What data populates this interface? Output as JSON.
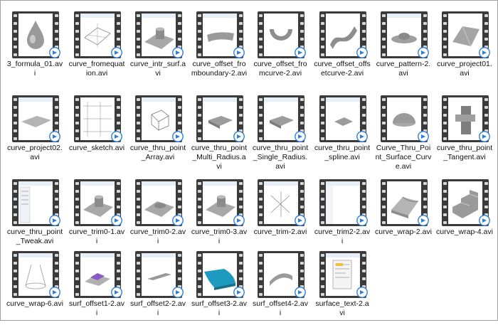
{
  "window": {
    "title": ""
  },
  "files": [
    {
      "name": "3_formula_01.avi",
      "thumb": "drop"
    },
    {
      "name": "curve_fromequation.avi",
      "thumb": "grid-plane"
    },
    {
      "name": "curve_intr_surf.avi",
      "thumb": "plate-cylinder"
    },
    {
      "name": "curve_offset_fromboundary-2.avi",
      "thumb": "wing"
    },
    {
      "name": "curve_offset_fromcurve-2.avi",
      "thumb": "halfring"
    },
    {
      "name": "curve_offset_offsetcurve-2.avi",
      "thumb": "wave"
    },
    {
      "name": "curve_pattern-2.avi",
      "thumb": "dish"
    },
    {
      "name": "curve_project01.avi",
      "thumb": "roof"
    },
    {
      "name": "curve_project02.avi",
      "thumb": "sheet"
    },
    {
      "name": "curve_sketch.avi",
      "thumb": "sketch-grid"
    },
    {
      "name": "curve_thru_point_Array.avi",
      "thumb": "wire-box"
    },
    {
      "name": "curve_thru_point_Multi_Radius.avi",
      "thumb": "wedge"
    },
    {
      "name": "curve_thru_point_Single_Radius.avi",
      "thumb": "wedge"
    },
    {
      "name": "curve_thru_point_spline.avi",
      "thumb": "wedge-small"
    },
    {
      "name": "Curve_Thru_Point_Surface_Curve.avi",
      "thumb": "dome"
    },
    {
      "name": "curve_thru_point_Tangent.avi",
      "thumb": "bracket"
    },
    {
      "name": "curve_thru_point_Tweak.avi",
      "thumb": "ui-panel"
    },
    {
      "name": "curve_trim0-1.avi",
      "thumb": "plate-cylinder"
    },
    {
      "name": "curve_trim0-2.avi",
      "thumb": "plate-bump"
    },
    {
      "name": "curve_trim0-3.avi",
      "thumb": "plate-cylinder"
    },
    {
      "name": "curve_trim-2.avi",
      "thumb": "star-wire"
    },
    {
      "name": "curve_trim2-2.avi",
      "thumb": "blank-ui"
    },
    {
      "name": "curve_wrap-2.avi",
      "thumb": "block-curve"
    },
    {
      "name": "curve_wrap-4.avi",
      "thumb": "steps"
    },
    {
      "name": "curve_wrap-6.avi",
      "thumb": "cone"
    },
    {
      "name": "surf_offset1-2.avi",
      "thumb": "purple-block"
    },
    {
      "name": "surf_offset2-2.avi",
      "thumb": "bar"
    },
    {
      "name": "surf_offset3-2.avi",
      "thumb": "cyan-sheet"
    },
    {
      "name": "surf_offset4-2.avi",
      "thumb": "arch"
    },
    {
      "name": "surface_text-2.avi",
      "thumb": "dialog"
    }
  ],
  "colors": {
    "film": "#3a3a3a",
    "badge": "#2f7fd8",
    "accent_cyan": "#1e9ac0",
    "accent_purple": "#8a5cc8"
  }
}
